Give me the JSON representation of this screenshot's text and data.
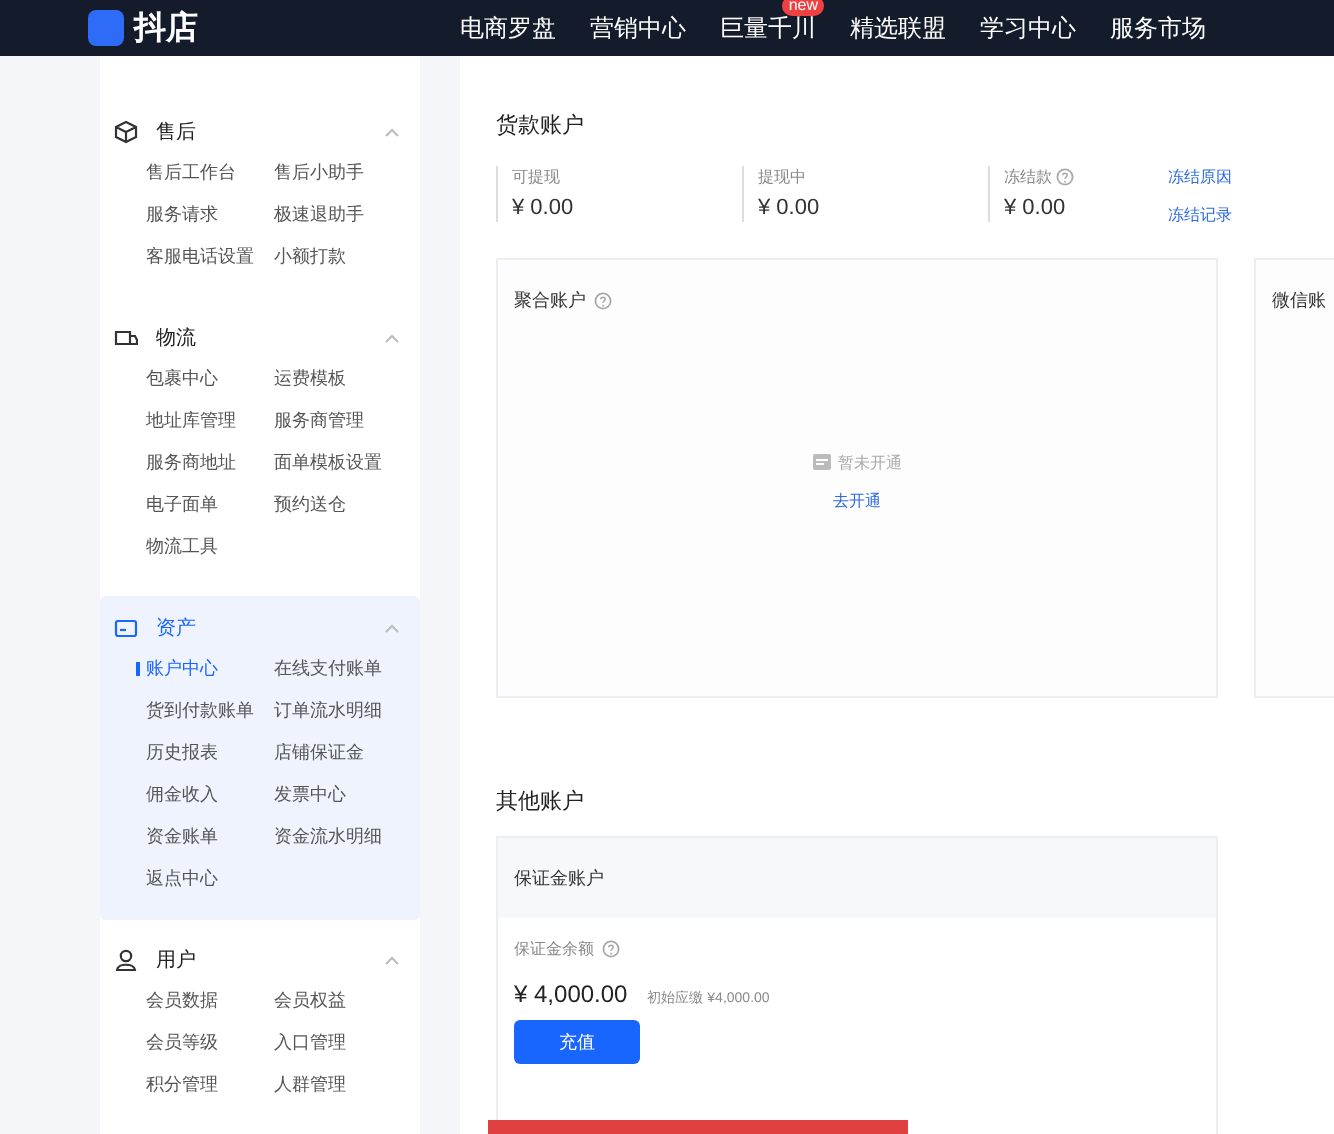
{
  "header": {
    "logo": "抖店",
    "nav": [
      {
        "label": "电商罗盘"
      },
      {
        "label": "营销中心"
      },
      {
        "label": "巨量千川",
        "badge": "new"
      },
      {
        "label": "精选联盟"
      },
      {
        "label": "学习中心"
      },
      {
        "label": "服务市场"
      }
    ]
  },
  "sidebar": {
    "sections": [
      {
        "title": "售后",
        "expanded": true,
        "selected": false,
        "items": [
          {
            "label": "售后工作台",
            "selected": false
          },
          {
            "label": "售后小助手",
            "selected": false
          },
          {
            "label": "服务请求",
            "selected": false
          },
          {
            "label": "极速退助手",
            "selected": false
          },
          {
            "label": "客服电话设置",
            "selected": false
          },
          {
            "label": "小额打款",
            "selected": false
          }
        ]
      },
      {
        "title": "物流",
        "expanded": true,
        "selected": false,
        "items": [
          {
            "label": "包裹中心",
            "selected": false
          },
          {
            "label": "运费模板",
            "selected": false
          },
          {
            "label": "地址库管理",
            "selected": false
          },
          {
            "label": "服务商管理",
            "selected": false
          },
          {
            "label": "服务商地址",
            "selected": false
          },
          {
            "label": "面单模板设置",
            "selected": false
          },
          {
            "label": "电子面单",
            "selected": false
          },
          {
            "label": "预约送仓",
            "selected": false
          },
          {
            "label": "物流工具",
            "selected": false
          }
        ]
      },
      {
        "title": "资产",
        "expanded": true,
        "selected": true,
        "items": [
          {
            "label": "账户中心",
            "selected": true
          },
          {
            "label": "在线支付账单",
            "selected": false
          },
          {
            "label": "货到付款账单",
            "selected": false
          },
          {
            "label": "订单流水明细",
            "selected": false
          },
          {
            "label": "历史报表",
            "selected": false
          },
          {
            "label": "店铺保证金",
            "selected": false
          },
          {
            "label": "佣金收入",
            "selected": false
          },
          {
            "label": "发票中心",
            "selected": false
          },
          {
            "label": "资金账单",
            "selected": false
          },
          {
            "label": "资金流水明细",
            "selected": false
          },
          {
            "label": "返点中心",
            "selected": false
          }
        ]
      },
      {
        "title": "用户",
        "expanded": true,
        "selected": false,
        "items": [
          {
            "label": "会员数据",
            "selected": false
          },
          {
            "label": "会员权益",
            "selected": false
          },
          {
            "label": "会员等级",
            "selected": false
          },
          {
            "label": "入口管理",
            "selected": false
          },
          {
            "label": "积分管理",
            "selected": false
          },
          {
            "label": "人群管理",
            "selected": false
          }
        ]
      }
    ]
  },
  "main": {
    "payment_account": {
      "title": "货款账户",
      "stats": [
        {
          "label": "可提现",
          "help": false,
          "value": "¥ 0.00"
        },
        {
          "label": "提现中",
          "help": false,
          "value": "¥ 0.00"
        },
        {
          "label": "冻结款",
          "help": true,
          "value": "¥ 0.00"
        }
      ],
      "links": [
        "冻结原因",
        "冻结记录"
      ]
    },
    "cards": [
      {
        "title": "聚合账户",
        "help": true,
        "empty_text": "暂未开通",
        "action": "去开通"
      },
      {
        "title": "微信账",
        "help": false
      }
    ],
    "other_accounts": {
      "title": "其他账户",
      "card": {
        "title": "保证金账户",
        "balance_label": "保证金余额",
        "amount": "¥ 4,000.00",
        "note": "初始应缴 ¥4,000.00",
        "button": "充值"
      }
    }
  }
}
